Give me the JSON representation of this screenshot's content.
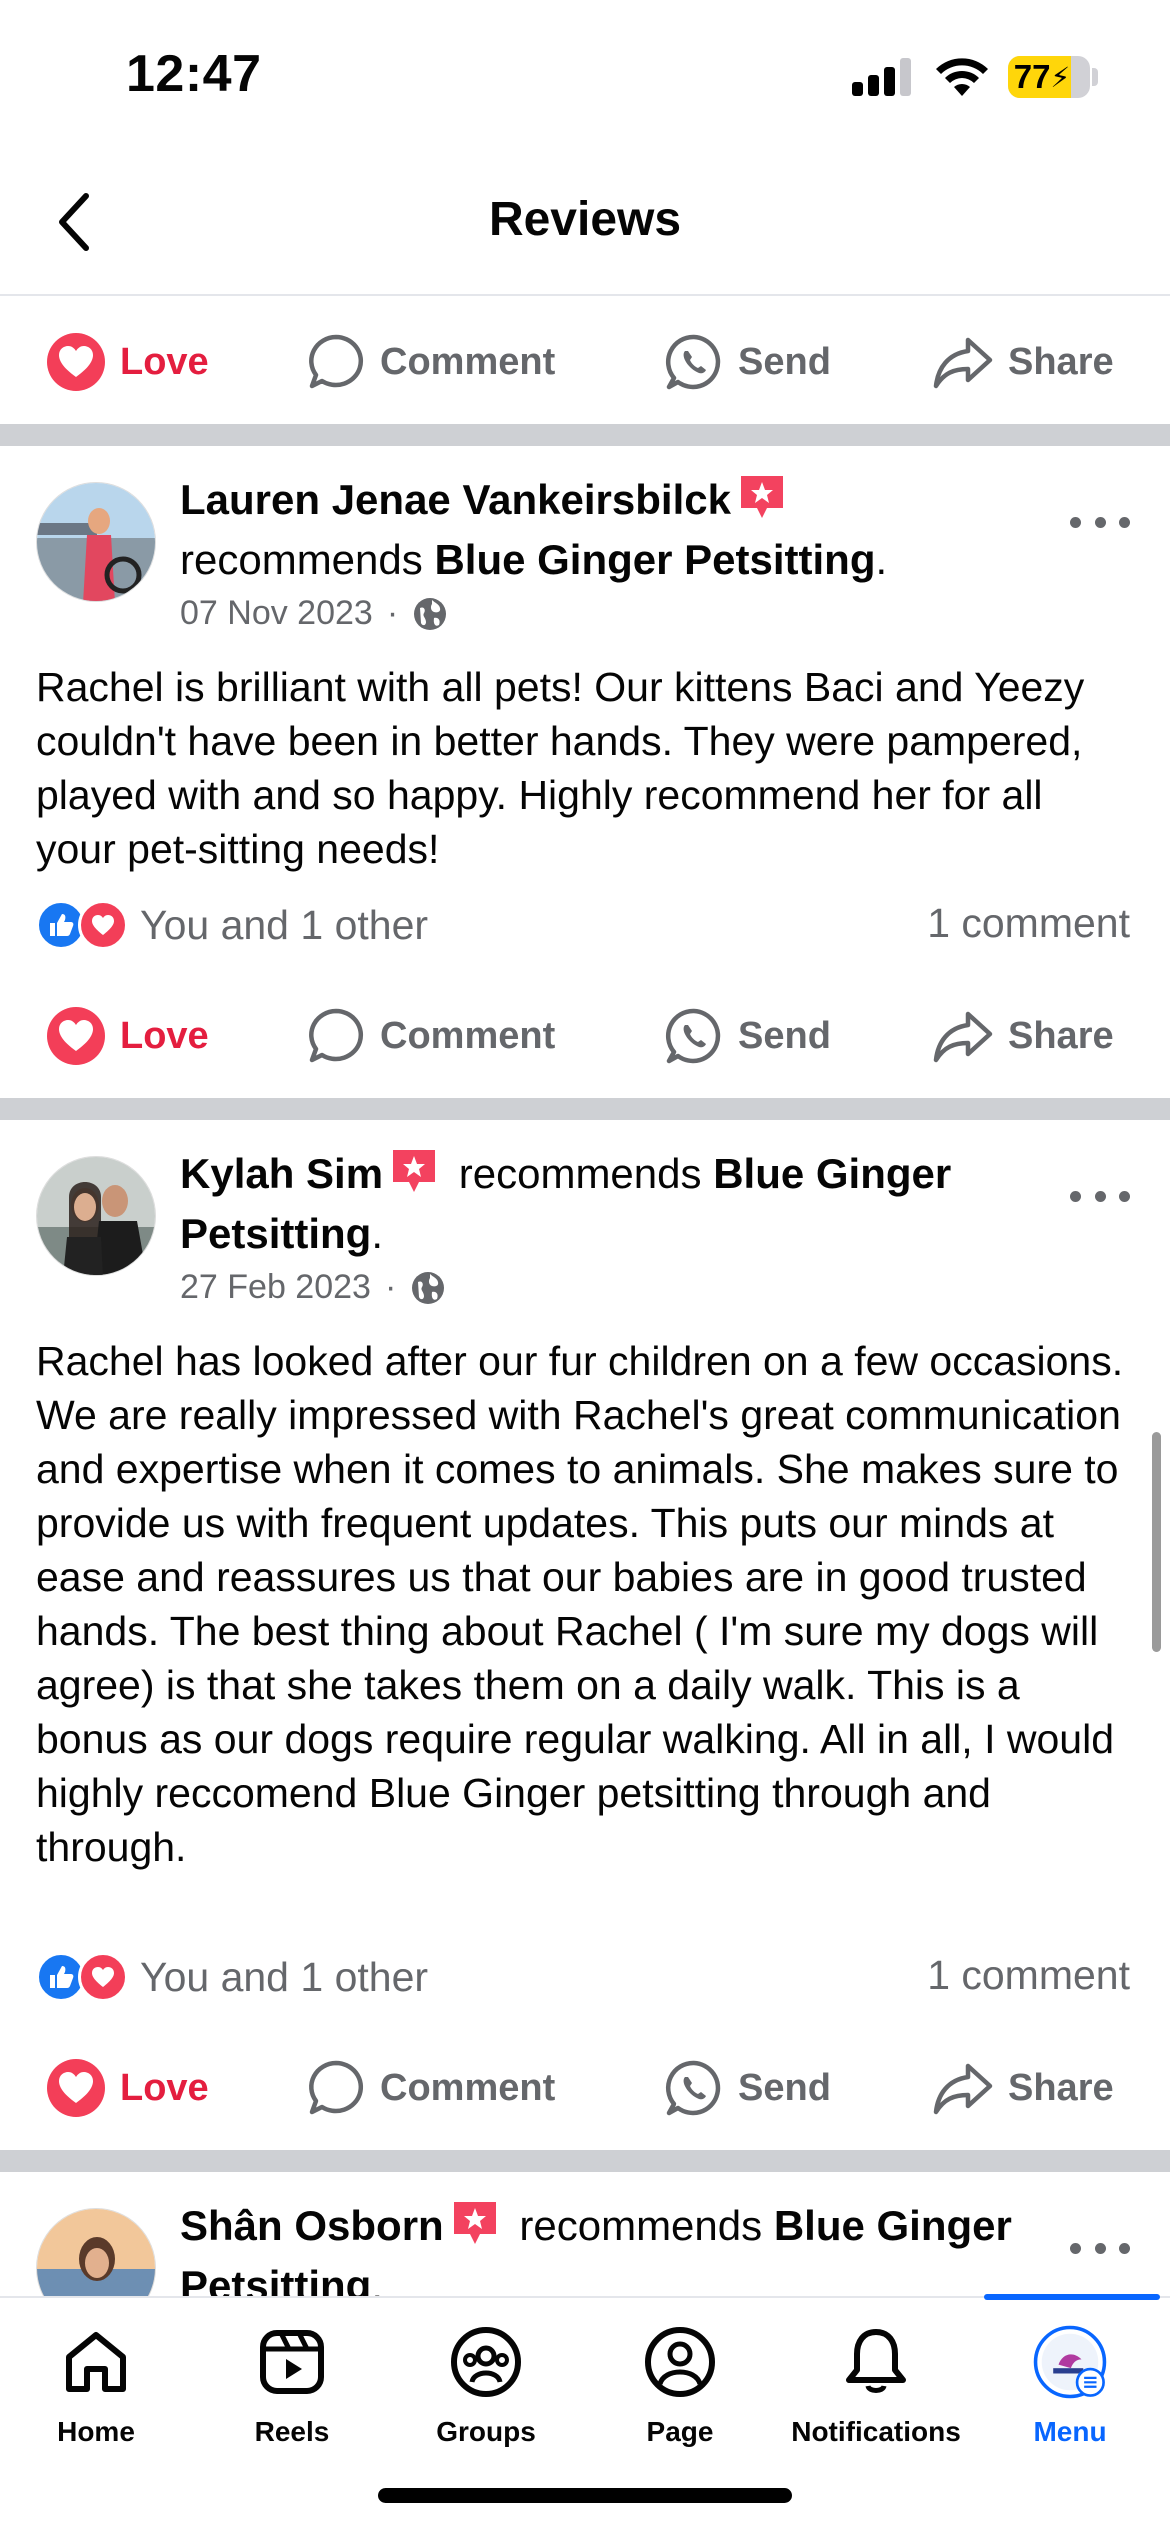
{
  "status_bar": {
    "time": "12:47",
    "battery": "77",
    "battery_level": 0.77
  },
  "header": {
    "title": "Reviews"
  },
  "actions": {
    "love": "Love",
    "comment": "Comment",
    "send": "Send",
    "share": "Share"
  },
  "posts": [
    {
      "author": "Lauren Jenae Vankeirsbilck",
      "verb": "recommends",
      "page": "Blue Ginger Petsitting",
      "date": "07 Nov 2023",
      "body": "Rachel is brilliant with all pets! Our kittens Baci and Yeezy couldn't have been in better hands. They were pampered, played with and so happy. Highly recommend her for all your pet-sitting needs!",
      "reactions": "You and 1 other",
      "comments": "1 comment"
    },
    {
      "author": "Kylah Sim",
      "verb": "recommends",
      "page": "Blue Ginger Petsitting",
      "date": "27 Feb 2023",
      "body": "Rachel has looked after our fur children on a few occasions. We are really impressed with Rachel's great communication and expertise when it comes to animals. She makes sure to provide us with frequent updates. This puts our minds at ease and reassures us that our babies are in good trusted hands. The best thing about Rachel ( I'm sure my dogs will agree) is that she takes them on a daily walk. This is a bonus as our dogs require regular walking. All in all, I would highly reccomend Blue Ginger petsitting through and through.",
      "reactions": "You and 1 other",
      "comments": "1 comment"
    },
    {
      "author": "Shân Osborn",
      "verb": "recommends",
      "page": "Blue Ginger Petsitting"
    }
  ],
  "tabs": [
    {
      "label": "Home",
      "icon": "home-icon"
    },
    {
      "label": "Reels",
      "icon": "reels-icon"
    },
    {
      "label": "Groups",
      "icon": "groups-icon"
    },
    {
      "label": "Page",
      "icon": "page-icon"
    },
    {
      "label": "Notifications",
      "icon": "bell-icon"
    },
    {
      "label": "Menu",
      "icon": "menu-avatar-icon",
      "active": true
    }
  ],
  "colors": {
    "love": "#e41e3f",
    "facebook_blue": "#0866ff",
    "secondary_text": "#65676b",
    "divider": "#ced0d4"
  }
}
